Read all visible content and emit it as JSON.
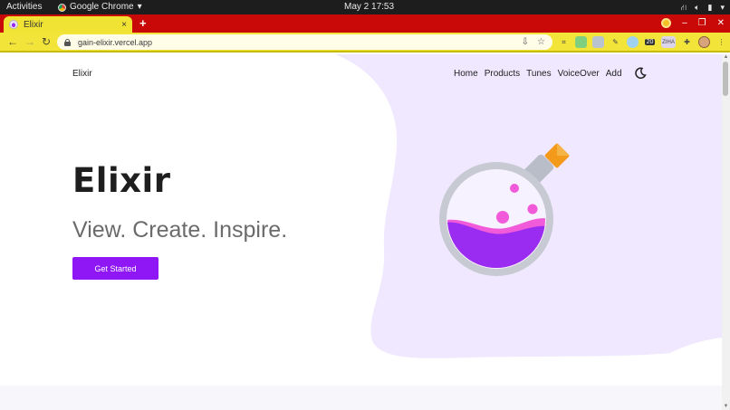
{
  "system_bar": {
    "activities": "Activities",
    "app_name": "Google Chrome",
    "app_menu_arrow": "▾",
    "clock": "May 2  17:53",
    "tray_icons": [
      "network-icon",
      "volume-icon",
      "battery-icon",
      "power-menu-icon"
    ]
  },
  "browser": {
    "tab_title": "Elixir",
    "tab_close": "×",
    "new_tab": "+",
    "window_controls": {
      "minimize": "–",
      "maximize": "❐",
      "close": "✕"
    },
    "url": "gain-elixir.vercel.app",
    "extension_badge": "20",
    "extension_short_label": "ZIHA"
  },
  "site": {
    "brand": "Elixir",
    "nav": [
      {
        "label": "Home"
      },
      {
        "label": "Products"
      },
      {
        "label": "Tunes"
      },
      {
        "label": "VoiceOver"
      },
      {
        "label": "Add"
      }
    ],
    "hero": {
      "title": "Elixir",
      "subtitle": "View. Create. Inspire.",
      "cta_label": "Get Started"
    }
  },
  "colors": {
    "accent": "#8f17f5",
    "blob": "#efe8fe",
    "potion_liquid": "#9a2cf2",
    "potion_bubbles": "#f15ad8",
    "potion_cork": "#f39a1b",
    "tab_strip": "#c90808",
    "tab_active": "#f1e334"
  }
}
